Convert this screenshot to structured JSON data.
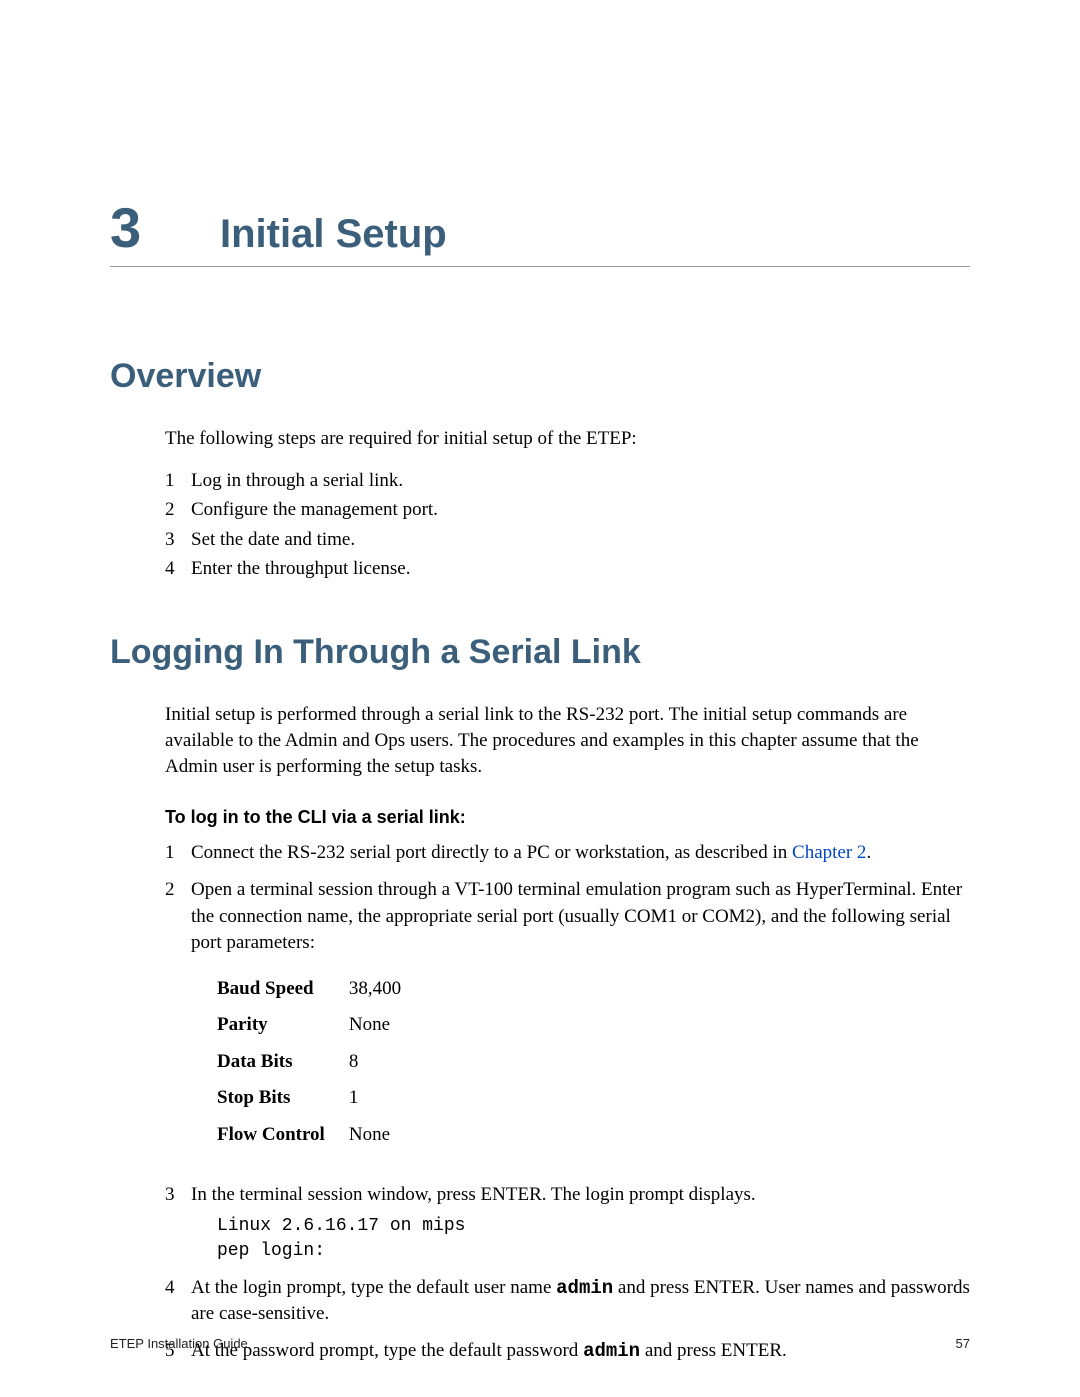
{
  "chapter": {
    "number": "3",
    "title": "Initial Setup"
  },
  "overview": {
    "heading": "Overview",
    "intro": "The following steps are required for initial setup of the ETEP:",
    "steps": [
      "Log in through a serial link.",
      "Configure the management port.",
      "Set the date and time.",
      "Enter the throughput license."
    ]
  },
  "serial": {
    "heading": "Logging In Through a Serial Link",
    "intro": "Initial setup is performed through a serial link to the RS-232 port. The initial setup commands are available to the Admin and Ops users. The procedures and examples in this chapter assume that the Admin user is performing the setup tasks.",
    "sub_heading": "To log in to the CLI via a serial link:",
    "step1_pre": "Connect the RS-232 serial port directly to a PC or workstation, as described in ",
    "step1_link": "Chapter 2",
    "step1_post": ".",
    "step2": "Open a terminal session through a VT-100 terminal emulation program such as HyperTerminal. Enter the connection name, the appropriate serial port (usually COM1 or COM2), and the following serial port parameters:",
    "params": {
      "baud_label": "Baud Speed",
      "baud_value": "38,400",
      "parity_label": "Parity",
      "parity_value": "None",
      "databits_label": "Data Bits",
      "databits_value": "8",
      "stopbits_label": "Stop Bits",
      "stopbits_value": "1",
      "flow_label": "Flow Control",
      "flow_value": "None"
    },
    "step3": "In the terminal session window, press ENTER. The login prompt displays.",
    "step3_code1": "Linux 2.6.16.17 on mips",
    "step3_code2": "pep login:",
    "step4_pre": "At the login prompt, type the default user name ",
    "step4_code": "admin",
    "step4_post": " and press ENTER. User names and passwords are case-sensitive.",
    "step5_pre": "At the password prompt, type the default password ",
    "step5_code": "admin",
    "step5_post": " and press ENTER."
  },
  "footer": {
    "left": "ETEP Installation Guide",
    "right": "57"
  }
}
